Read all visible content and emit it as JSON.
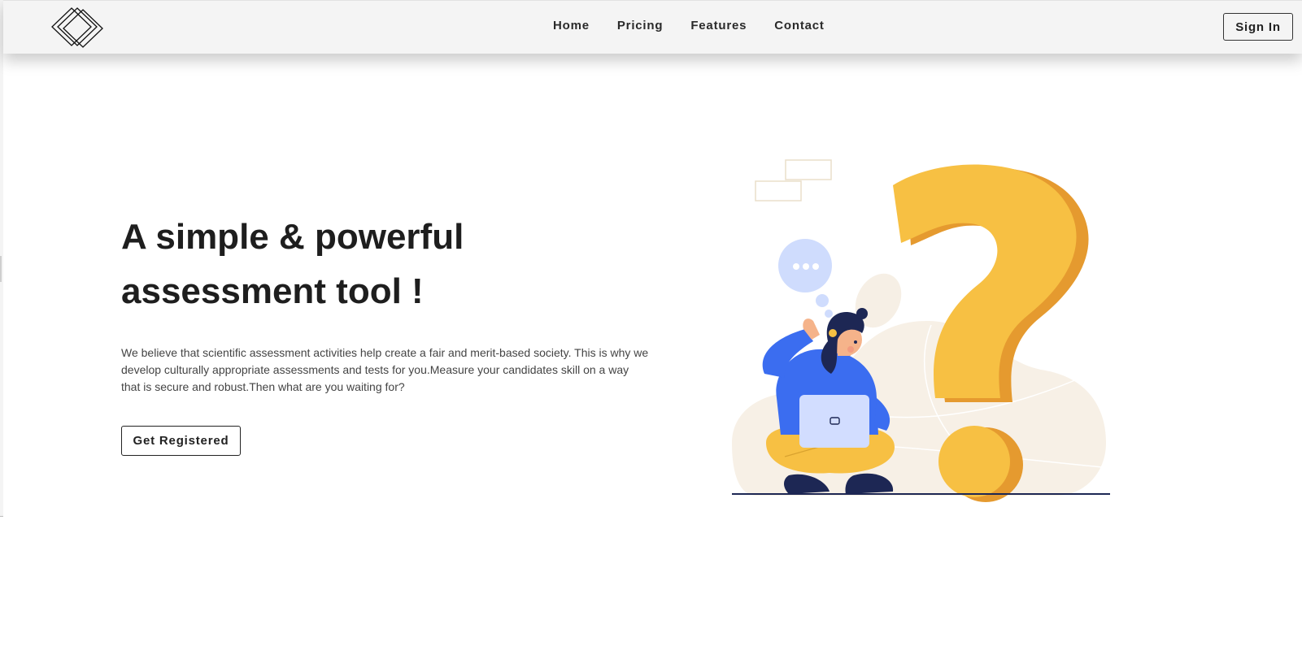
{
  "nav": {
    "links": [
      "Home",
      "Pricing",
      "Features",
      "Contact"
    ],
    "signin_label": "Sign In"
  },
  "hero": {
    "title_line1": "A simple & powerful",
    "title_line2": "assessment tool !",
    "description": "We believe that scientific assessment activities help create a fair and merit-based society. This is why we develop culturally appropriate assessments and tests for you.Measure your candidates skill on a way that is secure and robust.Then what are you waiting for?",
    "cta_label": "Get Registered"
  },
  "colors": {
    "nav_bg": "#f4f4f4",
    "question_yellow": "#f7c043",
    "question_orange": "#e59a2f",
    "shirt_blue": "#3b6df0",
    "laptop": "#d2ddff",
    "blob": "#f7f0e6"
  },
  "icons": {
    "logo": "stacked-diamonds-logo",
    "illustration": "person-with-laptop-question-mark"
  }
}
